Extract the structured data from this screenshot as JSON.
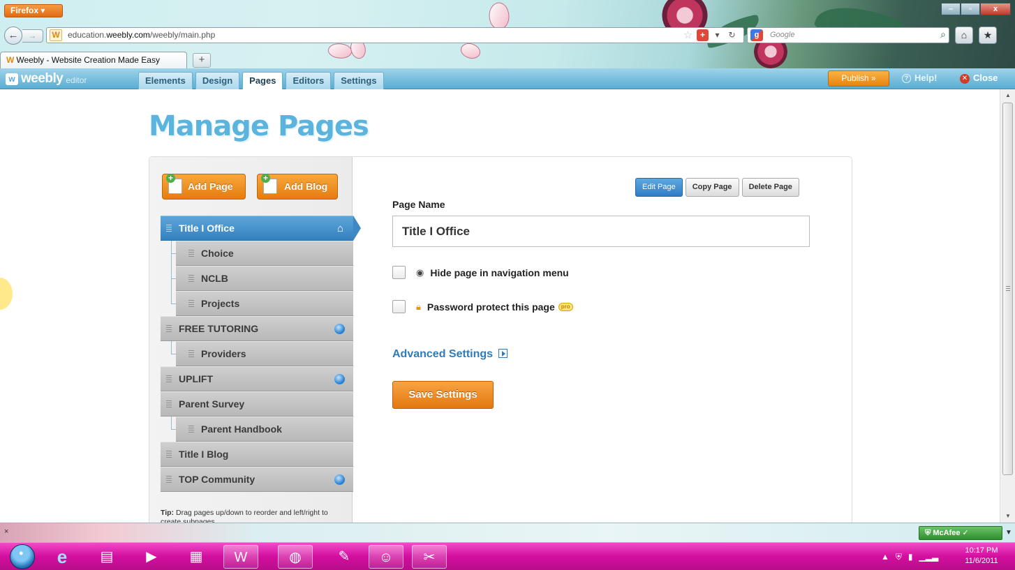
{
  "browser": {
    "menu_label": "Firefox",
    "url_domain_prefix": "education.",
    "url_domain": "weebly.com",
    "url_path": "/weebly/main.php",
    "search_placeholder": "Google",
    "tab_title": "Weebly - Website Creation Made Easy",
    "new_tab": "+",
    "favicon_letter": "W"
  },
  "editor": {
    "logo_text": "weebly",
    "logo_sub": "editor",
    "tabs": [
      {
        "label": "Elements"
      },
      {
        "label": "Design"
      },
      {
        "label": "Pages"
      },
      {
        "label": "Editors"
      },
      {
        "label": "Settings"
      }
    ],
    "active_tab": "Pages",
    "publish_label": "Publish »",
    "help_label": "Help!",
    "close_label": "Close"
  },
  "page": {
    "title": "Manage Pages",
    "add_page_label": "Add Page",
    "add_blog_label": "Add Blog",
    "pages": [
      {
        "label": "Title I Office"
      },
      {
        "label": "Choice"
      },
      {
        "label": "NCLB"
      },
      {
        "label": "Projects"
      },
      {
        "label": "FREE TUTORING"
      },
      {
        "label": "Providers"
      },
      {
        "label": "UPLIFT"
      },
      {
        "label": "Parent Survey"
      },
      {
        "label": "Parent Handbook"
      },
      {
        "label": "Title I Blog"
      },
      {
        "label": "TOP Community"
      }
    ],
    "tip_bold": "Tip:",
    "tip_text": "Drag pages up/down to reorder and left/right to create subpages."
  },
  "settings": {
    "edit_page_label": "Edit Page",
    "copy_page_label": "Copy Page",
    "delete_page_label": "Delete Page",
    "page_name_label": "Page Name",
    "page_name_value": "Title I Office",
    "hide_label": "Hide page in navigation menu",
    "password_label": "Password protect this page",
    "pro_badge": "pro",
    "advanced_label": "Advanced Settings",
    "save_label": "Save Settings"
  },
  "addon_bar": {
    "close": "×",
    "mcafee_label": "McAfee"
  },
  "taskbar": {
    "time": "10:17 PM",
    "date": "11/6/2011"
  }
}
